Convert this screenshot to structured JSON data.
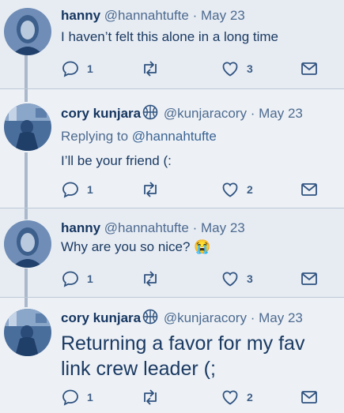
{
  "tweets": [
    {
      "name": "hanny",
      "handle": "@hannahtufte",
      "separator": "·",
      "date": "May 23",
      "text": "I haven’t felt this alone in a long time",
      "reply_count": "1",
      "retweet_count": "",
      "like_count": "3"
    },
    {
      "name": "cory kunjara",
      "handle": "@kunjaracory",
      "separator": "·",
      "date": "May 23",
      "replying_prefix": "Replying to",
      "replying_to": "@hannahtufte",
      "text": "I’ll be your friend (:",
      "reply_count": "1",
      "retweet_count": "",
      "like_count": "2"
    },
    {
      "name": "hanny",
      "handle": "@hannahtufte",
      "separator": "·",
      "date": "May 23",
      "text": "Why are you so nice?",
      "emoji": "😭",
      "reply_count": "1",
      "retweet_count": "",
      "like_count": "3"
    },
    {
      "name": "cory kunjara",
      "handle": "@kunjaracory",
      "separator": "·",
      "date": "May 23",
      "text": "Returning a favor for my fav link crew leader (;",
      "reply_count": "1",
      "retweet_count": "",
      "like_count": "2"
    }
  ],
  "icons": {
    "reply": "reply-icon",
    "retweet": "retweet-icon",
    "like": "heart-icon",
    "message": "envelope-icon",
    "name_badge": "basketball-icon"
  },
  "colors": {
    "tint": "#1d3f6b",
    "background": "#e7ecf3",
    "thread_line": "#aab8cb"
  }
}
